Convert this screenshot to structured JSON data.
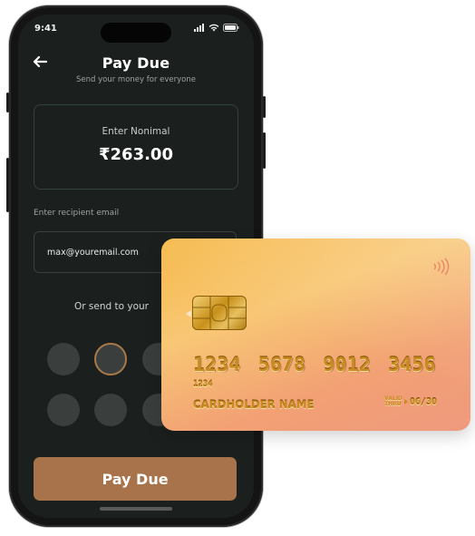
{
  "status_bar": {
    "time": "9:41"
  },
  "header": {
    "title": "Pay Due",
    "subtitle": "Send your money for everyone"
  },
  "amount": {
    "label": "Enter Nonimal",
    "value": "₹263.00"
  },
  "recipient": {
    "label": "Enter recipient email",
    "value": "max@youremail.com"
  },
  "send_to": {
    "label": "Or send to your"
  },
  "avatars": [
    {
      "selected": false
    },
    {
      "selected": true
    },
    {
      "selected": false
    },
    {
      "selected": false
    },
    {
      "selected": false
    },
    {
      "selected": false
    }
  ],
  "pay_button": {
    "label": "Pay Due"
  },
  "card": {
    "number": "1234 5678 9012 3456",
    "short_number": "1234",
    "holder": "CARDHOLDER NAME",
    "valid_label_1": "VALID",
    "valid_label_2": "THRU",
    "valid_date": "06/30"
  },
  "colors": {
    "screen_bg": "#1b201f",
    "accent": "#a8734a",
    "card_gold": "#c98a1f"
  },
  "icons": [
    "back-arrow-icon",
    "signal-icon",
    "wifi-icon",
    "battery-icon",
    "contactless-icon",
    "chip-icon"
  ]
}
